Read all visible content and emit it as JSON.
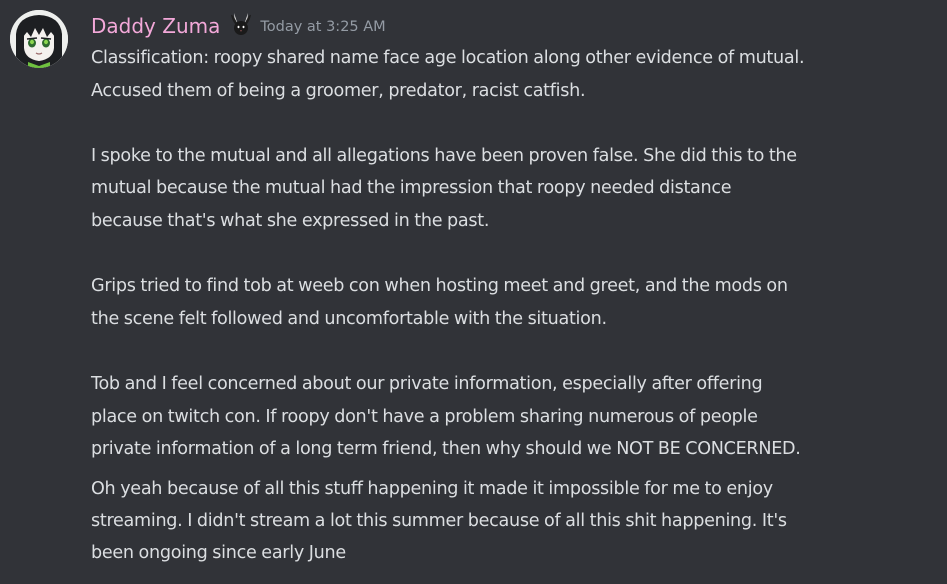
{
  "message": {
    "author": {
      "name": "Daddy Zuma",
      "color": "#f3a8d9",
      "avatar_icon": "anime-girl-avatar",
      "role_icon": "bunny-role-icon"
    },
    "timestamp": "Today at 3:25 AM",
    "lines": [
      "Classification: roopy shared name face age location along other evidence of mutual.",
      "Accused them of being a groomer, predator, racist catfish.",
      "I spoke to the mutual and all allegations have been proven false. She did this to the",
      "mutual because the mutual had the impression that roopy needed distance",
      "because that's what she expressed in the past.",
      "Grips tried to find tob at weeb con when hosting meet and greet, and the mods on",
      "the scene felt followed and uncomfortable with the situation.",
      "Tob and I feel concerned about our private information, especially after offering",
      "place on twitch con. If roopy don't have a problem sharing numerous of people",
      "private information of a long term friend, then why should we NOT BE CONCERNED."
    ],
    "followup_lines": [
      "Oh yeah because of all this stuff happening it made it impossible for me to enjoy",
      "streaming. I didn't stream a lot this summer because of all this shit happening. It's",
      "been ongoing since early June"
    ]
  },
  "colors": {
    "background": "#313338",
    "text": "#dbdee1",
    "timestamp": "#949ba4"
  }
}
